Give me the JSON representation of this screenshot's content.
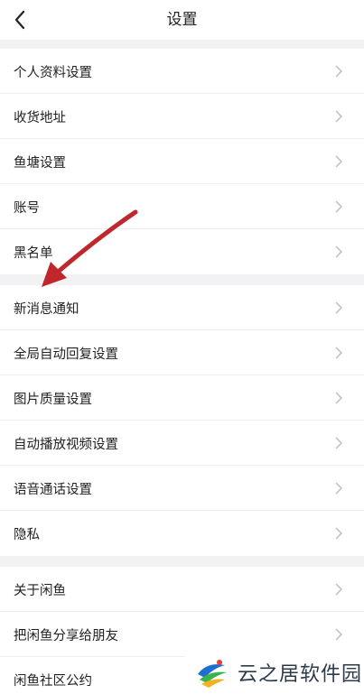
{
  "header": {
    "title": "设置"
  },
  "groups": [
    {
      "items": [
        {
          "label": "个人资料设置"
        },
        {
          "label": "收货地址"
        },
        {
          "label": "鱼塘设置"
        },
        {
          "label": "账号"
        },
        {
          "label": "黑名单"
        }
      ]
    },
    {
      "items": [
        {
          "label": "新消息通知"
        },
        {
          "label": "全局自动回复设置"
        },
        {
          "label": "图片质量设置"
        },
        {
          "label": "自动播放视频设置"
        },
        {
          "label": "语音通话设置"
        },
        {
          "label": "隐私"
        }
      ]
    },
    {
      "items": [
        {
          "label": "关于闲鱼"
        },
        {
          "label": "把闲鱼分享给朋友"
        },
        {
          "label": "闲鱼社区公约"
        }
      ]
    }
  ],
  "annotation": {
    "color": "#c0272d",
    "icon": "red-arrow-pointing-to-new-message-notifications"
  },
  "watermark": {
    "text": "云之居软件园"
  },
  "colors": {
    "background": "#ffffff",
    "group_gap": "#f2f2f4",
    "text": "#222222",
    "chevron": "#c4c4c4"
  }
}
